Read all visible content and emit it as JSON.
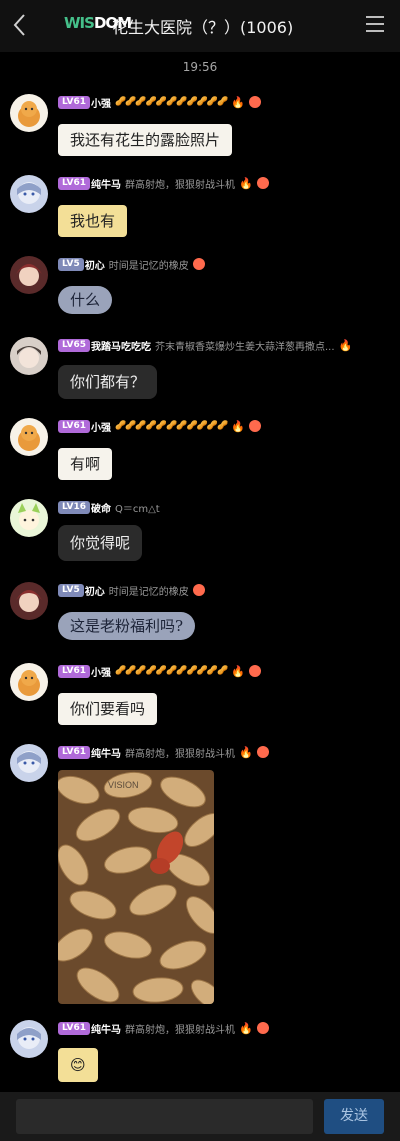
{
  "header": {
    "title": "花生大医院（？）(1006)",
    "logo_text_left": "WIS",
    "logo_text_right": "DOM"
  },
  "timestamp": "19:56",
  "messages": [
    {
      "level": "LV61",
      "name": "小强",
      "signature": "🥜🥜🥜🥜🥜🥜🥜🥜🥜🥜🥜",
      "text": "我还有花生的露脸照片"
    },
    {
      "level": "LV61",
      "name": "纯牛马",
      "signature": "群高射炮，狠狠射战斗机",
      "text": "我也有"
    },
    {
      "level": "LV5",
      "name": "初心",
      "signature": "时间是记忆的橡皮",
      "text": "什么"
    },
    {
      "level": "LV65",
      "name": "我踏马吃吃吃",
      "signature": "芥末青椒香菜爆炒生姜大蒜洋葱再撒点...",
      "text": "你们都有？"
    },
    {
      "level": "LV61",
      "name": "小强",
      "signature": "🥜🥜🥜🥜🥜🥜🥜🥜🥜🥜🥜",
      "text": "有啊"
    },
    {
      "level": "LV16",
      "name": "破命",
      "signature": "Q＝cm△t",
      "text": "你觉得呢"
    },
    {
      "level": "LV5",
      "name": "初心",
      "signature": "时间是记忆的橡皮",
      "text": "这是老粉福利吗?"
    },
    {
      "level": "LV61",
      "name": "小强",
      "signature": "🥜🥜🥜🥜🥜🥜🥜🥜🥜🥜🥜",
      "text": "你们要看吗"
    },
    {
      "level": "LV61",
      "name": "纯牛马",
      "signature": "群高射炮，狠狠射战斗机",
      "image_watermark": "VISION"
    },
    {
      "level": "LV61",
      "name": "纯牛马",
      "signature": "群高射炮，狠狠射战斗机",
      "text": "😊"
    }
  ],
  "composer": {
    "placeholder": "",
    "send_label": "发送"
  },
  "colors": {
    "lv_purple": "#b06ad9",
    "lv_blue": "#7f8ab8",
    "send_button": "#1f4e82"
  }
}
